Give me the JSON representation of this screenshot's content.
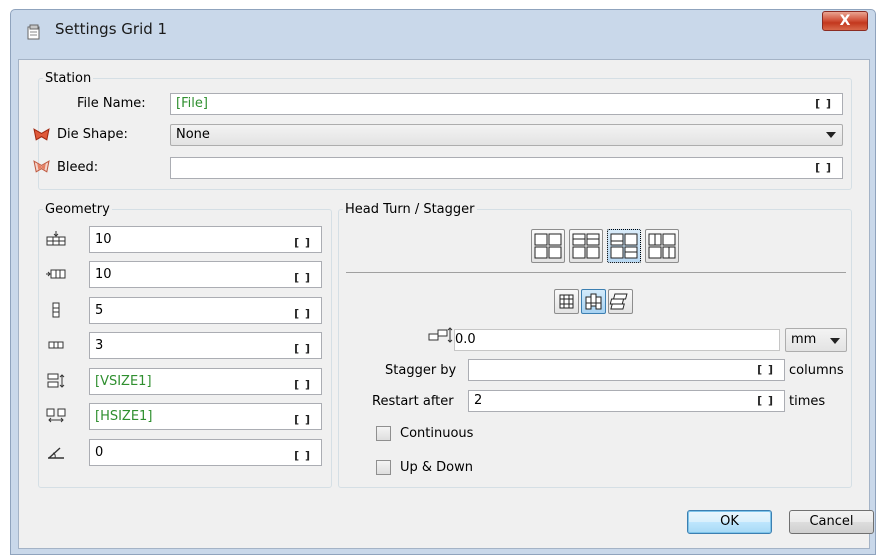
{
  "window": {
    "title": "Settings Grid 1",
    "close_label": "X"
  },
  "station": {
    "group_title": "Station",
    "file_name_label": "File Name:",
    "file_name_value": "[File]",
    "die_shape_label": "Die Shape:",
    "die_shape_value": "None",
    "bleed_label": "Bleed:",
    "bleed_value": ""
  },
  "bracket_symbol": "[ ]",
  "geometry": {
    "group_title": "Geometry",
    "rows": [
      {
        "icon": "columns-count-icon",
        "value": "10"
      },
      {
        "icon": "rows-count-icon",
        "value": "10"
      },
      {
        "icon": "vertical-gap-icon",
        "value": "5"
      },
      {
        "icon": "horizontal-gap-icon",
        "value": "3"
      },
      {
        "icon": "vertical-size-icon",
        "value": "[VSIZE1]"
      },
      {
        "icon": "horizontal-size-icon",
        "value": "[HSIZE1]"
      },
      {
        "icon": "rotation-angle-icon",
        "value": "0"
      }
    ]
  },
  "head_turn": {
    "group_title": "Head Turn / Stagger",
    "layout_buttons": [
      "layout-normal",
      "layout-head-turn-rows",
      "layout-head-turn-quad",
      "layout-head-turn-cols"
    ],
    "selected_layout": 2,
    "stagger_modes": [
      "grid",
      "stagger-vertical",
      "stagger-horizontal"
    ],
    "selected_stagger": 1,
    "offset_value": "0.0",
    "unit_value": "mm",
    "stagger_by_label": "Stagger by",
    "stagger_by_value": "",
    "stagger_by_suffix": "columns",
    "restart_after_label": "Restart after",
    "restart_after_value": "2",
    "restart_after_suffix": "times",
    "continuous_label": "Continuous",
    "up_down_label": "Up & Down"
  },
  "buttons": {
    "ok": "OK",
    "cancel": "Cancel"
  }
}
